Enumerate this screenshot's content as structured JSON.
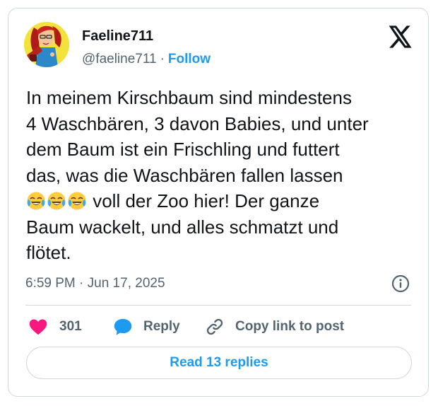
{
  "author": {
    "display_name": "Faeline711",
    "handle": "@faeline711",
    "separator": "·",
    "follow_label": "Follow",
    "avatar_icon": "avatar-illustration"
  },
  "brand": {
    "logo_icon": "x-logo-icon"
  },
  "tweet": {
    "text_part1": "In meinem Kirschbaum sind mindestens\n4 Waschbären, 3 davon Babies, und unter\ndem Baum ist ein Frischling und futtert\ndas, was die Waschbären fallen lassen\n",
    "emoji": [
      "😂",
      "😂",
      "😂"
    ],
    "text_part2": " voll der Zoo hier! Der ganze\nBaum wackelt, und alles schmatzt und\nflötet.",
    "timestamp": "6:59 PM · Jun 17, 2025"
  },
  "actions": {
    "like_count": "301",
    "reply_label": "Reply",
    "copy_link_label": "Copy link to post",
    "read_replies_label": "Read 13 replies"
  },
  "colors": {
    "accent": "#1d9bf0",
    "like": "#f91880",
    "text": "#0f1419",
    "muted": "#536471",
    "border": "#cfd9de"
  }
}
